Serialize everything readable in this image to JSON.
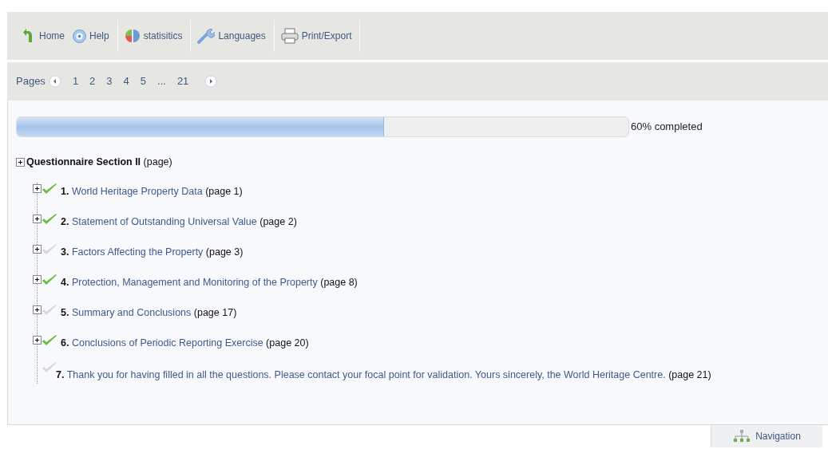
{
  "toolbar": [
    {
      "kind": "home",
      "label": "Home"
    },
    {
      "kind": "help",
      "label": "Help"
    },
    {
      "kind": "stats",
      "label": "statisitics"
    },
    {
      "kind": "languages",
      "label": "Languages"
    },
    {
      "kind": "print",
      "label": "Print/Export"
    }
  ],
  "pager": {
    "label": "Pages",
    "pages": [
      "1",
      "2",
      "3",
      "4",
      "5",
      "...",
      "21"
    ]
  },
  "progress": {
    "level": 0.6,
    "reading": "60% completed"
  },
  "tree": {
    "title": "Questionnaire Section II",
    "suffix": "(page)",
    "expandable": true,
    "children": [
      {
        "number": "1.",
        "title": "World Heritage Property Data",
        "suffix": "(page 1)",
        "done": true,
        "expandable": true
      },
      {
        "number": "2.",
        "title": "Statement of Outstanding Universal Value",
        "suffix": "(page 2)",
        "done": true,
        "expandable": true
      },
      {
        "number": "3.",
        "title": "Factors Affecting the Property",
        "suffix": "(page 3)",
        "done": false,
        "expandable": true
      },
      {
        "number": "4.",
        "title": "Protection, Management and Monitoring of the Property",
        "suffix": "(page 8)",
        "done": true,
        "expandable": true
      },
      {
        "number": "5.",
        "title": "Summary and Conclusions",
        "suffix": "(page 17)",
        "done": false,
        "expandable": true
      },
      {
        "number": "6.",
        "title": "Conclusions of Periodic Reporting Exercise",
        "suffix": "(page 20)",
        "done": true,
        "expandable": true
      },
      {
        "number": "7.",
        "title": "Thank you for having filled in all the questions. Please contact your focal point for validation. Yours sincerely, the World Heritage Centre.",
        "suffix": "(page 21)",
        "done": false,
        "expandable": false
      }
    ]
  },
  "footer": {
    "button": "Navigation"
  }
}
